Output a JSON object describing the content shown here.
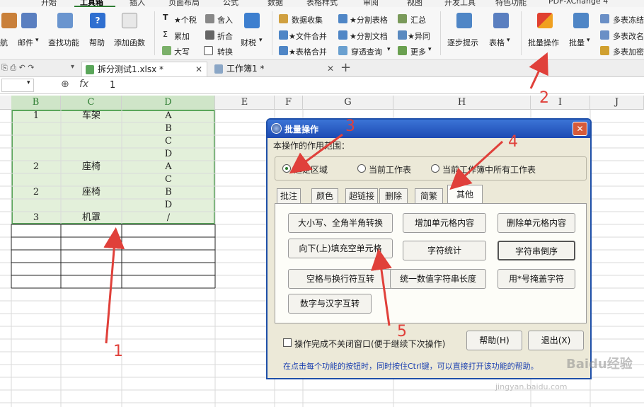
{
  "ribbon": {
    "tabs": [
      "开始",
      "工具箱",
      "插入",
      "页面布局",
      "公式",
      "数据",
      "表格样式",
      "审阅",
      "视图",
      "开发工具",
      "特色功能",
      "PDF-XChange 4"
    ],
    "active_tab": "工具箱",
    "items": {
      "nav": "航",
      "mail": "邮件",
      "find_func": "查找功能",
      "help": "帮助",
      "add_func": "添加函数",
      "tax": "★个税",
      "sum": "累加",
      "upper": "大写",
      "round": "舍入",
      "discount": "折合",
      "convert": "转换",
      "finance": "财税",
      "collect": "数据收集",
      "file_merge": "★文件合并",
      "table_merge": "★表格合并",
      "split_table": "★分割表格",
      "split_doc": "★分割文档",
      "penetrate": "穿透查询",
      "summary": "汇总",
      "outlier": "★异同",
      "more": "更多",
      "step_hint": "逐步提示",
      "table_fmt": "表格",
      "batch_op": "批量操作",
      "batch": "批量",
      "multi_freeze": "多表冻结",
      "multi_rename": "多表改名",
      "multi_add": "多表加密"
    }
  },
  "doc_tabs": [
    {
      "label": "拆分测试1.xlsx *",
      "active": true
    },
    {
      "label": "工作簿1 *",
      "active": false
    }
  ],
  "formula_bar": {
    "fx": "fx",
    "value": "1"
  },
  "sheet": {
    "columns": [
      "B",
      "C",
      "D",
      "E",
      "F",
      "G",
      "H",
      "I",
      "J"
    ],
    "rows": [
      {
        "b": "1",
        "c": "车架",
        "d": "A"
      },
      {
        "b": "",
        "c": "",
        "d": "B"
      },
      {
        "b": "",
        "c": "",
        "d": "C"
      },
      {
        "b": "",
        "c": "",
        "d": "D"
      },
      {
        "b": "2",
        "c": "座椅",
        "d": "A"
      },
      {
        "b": "",
        "c": "",
        "d": "C"
      },
      {
        "b": "2",
        "c": "座椅",
        "d": "B"
      },
      {
        "b": "",
        "c": "",
        "d": "D"
      },
      {
        "b": "3",
        "c": "机罩",
        "d": "/"
      }
    ]
  },
  "dialog": {
    "title": "批量操作",
    "scope_label": "本操作的作用范围：",
    "scopes": [
      "选定区域",
      "当前工作表",
      "当前工作簿中所有工作表"
    ],
    "selected_scope": 0,
    "tabs": [
      "批注",
      "颜色",
      "超链接",
      "删除",
      "简繁",
      "其他"
    ],
    "active_tab": "其他",
    "functions": [
      "大小写、全角半角转换",
      "增加单元格内容",
      "删除单元格内容",
      "向下(上)填充空单元格",
      "字符统计",
      "字符串倒序",
      "空格与换行符互转",
      "统一数值字符串长度",
      "用*号掩盖字符",
      "数字与汉字互转"
    ],
    "keep_open": "操作完成不关闭窗口(便于继续下次操作)",
    "help_btn": "帮助(H)",
    "exit_btn": "退出(X)",
    "hint": "在点击每个功能的按钮时，同时按住Ctrl键，可以直接打开该功能的帮助。"
  },
  "annotations": [
    "1",
    "2",
    "3",
    "4",
    "5"
  ],
  "watermark": {
    "brand": "Baidu经验",
    "url": "jingyan.baidu.com"
  },
  "colors": {
    "accent": "#2e7d32",
    "selection": "#e3f0da",
    "dialog_title": "#1d4ab3",
    "annotation": "#e0403a"
  }
}
